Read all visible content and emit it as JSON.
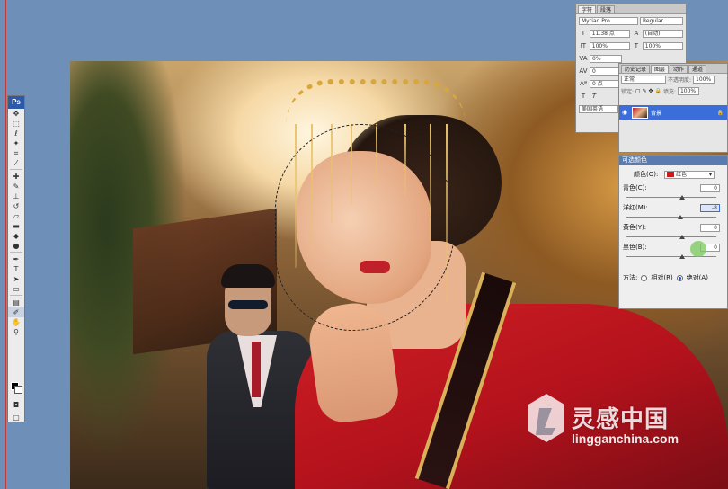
{
  "app": {
    "logo": "Ps"
  },
  "character_panel": {
    "tabs": [
      "字符",
      "段落"
    ],
    "font_family": "Myriad Pro",
    "font_style": "Regular",
    "font_size": "11.38 点",
    "leading": "(自动)",
    "vertical_scale": "100%",
    "horizontal_scale": "100%",
    "tracking": "0%",
    "kerning": "0",
    "baseline": "0 点",
    "language": "美国英语"
  },
  "layers_panel": {
    "tabs": [
      "历史记录",
      "图层",
      "动作",
      "通道"
    ],
    "blend_mode": "正常",
    "opacity_label": "不透明度:",
    "opacity": "100%",
    "lock_label": "锁定:",
    "fill_label": "填充:",
    "fill": "100%",
    "layer_name": "背景"
  },
  "selective_color": {
    "title": "可选颜色",
    "colors_label": "颜色(O):",
    "colors_value": "红色",
    "swatch_color": "#d01a1a",
    "cyan_label": "青色(C):",
    "cyan": "0",
    "magenta_label": "洋红(M):",
    "magenta": "-8",
    "yellow_label": "黄色(Y):",
    "yellow": "0",
    "black_label": "黑色(B):",
    "black": "0",
    "method_label": "方法:",
    "method_relative": "相对(R)",
    "method_absolute": "绝对(A)"
  },
  "watermark": {
    "cn": "灵感中国",
    "url": "lingganchina.com"
  }
}
